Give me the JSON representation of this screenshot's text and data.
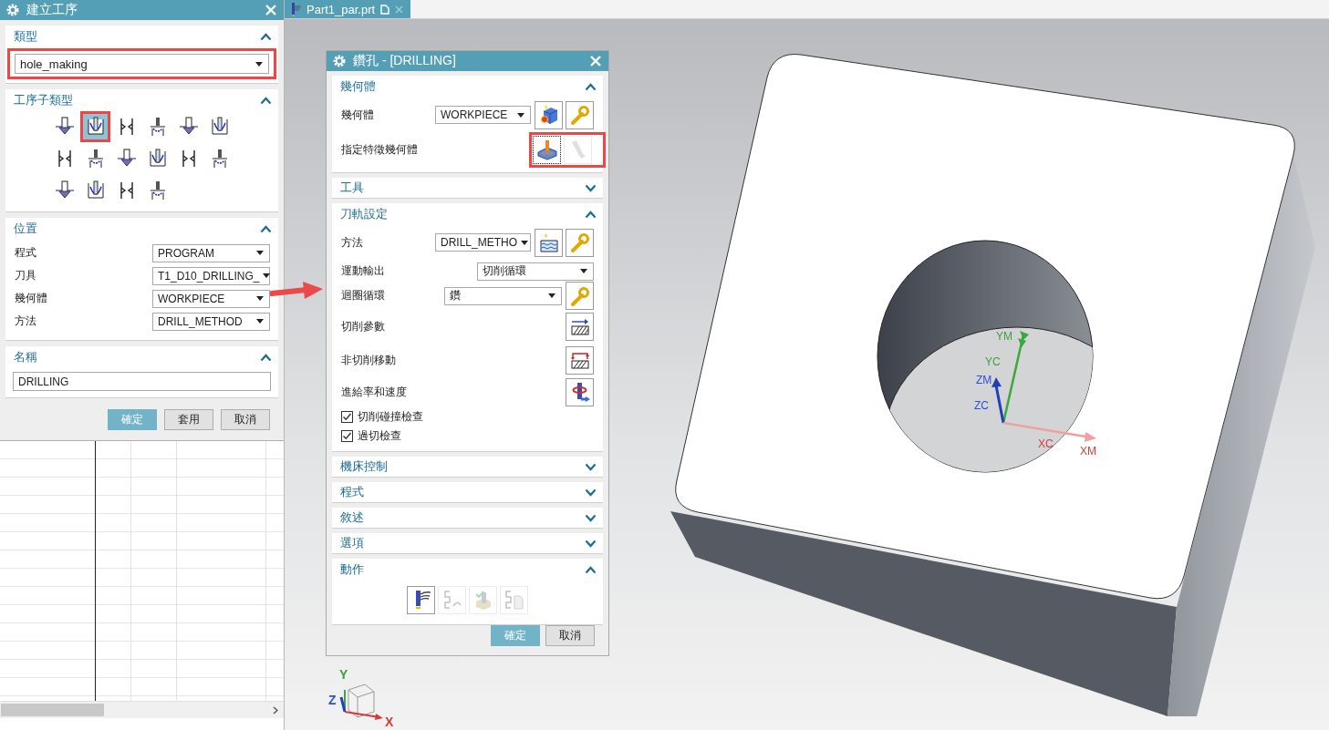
{
  "left_dialog": {
    "title": "建立工序",
    "sections": [
      {
        "kind": "type",
        "title": "類型",
        "expanded": true,
        "value": "hole_making",
        "highlighted": true
      },
      {
        "kind": "subtypes",
        "title": "工序子類型",
        "expanded": true,
        "items": [
          {
            "selected": false,
            "highlighted": false
          },
          {
            "selected": true,
            "highlighted": true
          },
          {
            "selected": false,
            "highlighted": false
          },
          {
            "selected": false,
            "highlighted": false
          },
          {
            "selected": false,
            "highlighted": false
          },
          {
            "selected": false,
            "highlighted": false
          },
          {
            "selected": false,
            "highlighted": false
          },
          {
            "selected": false,
            "highlighted": false
          },
          {
            "selected": false,
            "highlighted": false
          },
          {
            "selected": false,
            "highlighted": false
          },
          {
            "selected": false,
            "highlighted": false
          },
          {
            "selected": false,
            "highlighted": false
          },
          {
            "selected": false,
            "highlighted": false
          },
          {
            "selected": false,
            "highlighted": false
          },
          {
            "selected": false,
            "highlighted": false
          },
          {
            "selected": false,
            "highlighted": false
          }
        ]
      },
      {
        "kind": "fields",
        "title": "位置",
        "expanded": true,
        "fields": [
          {
            "label": "程式",
            "value": "PROGRAM"
          },
          {
            "label": "刀具",
            "value": "T1_D10_DRILLING_"
          },
          {
            "label": "幾何體",
            "value": "WORKPIECE"
          },
          {
            "label": "方法",
            "value": "DRILL_METHOD"
          }
        ]
      },
      {
        "kind": "name",
        "title": "名稱",
        "expanded": true,
        "value": "DRILLING"
      }
    ],
    "buttons": [
      {
        "label": "確定",
        "kind": "primary"
      },
      {
        "label": "套用",
        "kind": "normal"
      },
      {
        "label": "取消",
        "kind": "normal"
      }
    ]
  },
  "part_tab": {
    "label": "Part1_par.prt"
  },
  "drill_dialog": {
    "title": "鑽孔 - [DRILLING]",
    "sections": [
      {
        "title": "幾何體",
        "expanded": true,
        "rows": [
          {
            "kind": "geometry",
            "label": "幾何體",
            "value": "WORKPIECE"
          },
          {
            "kind": "feature",
            "label": "指定特徵幾何體",
            "highlighted": true,
            "tools": [
              {
                "disabled": false
              },
              {
                "disabled": true
              }
            ]
          }
        ]
      },
      {
        "title": "工具",
        "expanded": false
      },
      {
        "title": "刀軌設定",
        "expanded": true,
        "rows": [
          {
            "kind": "method",
            "label": "方法",
            "value": "DRILL_METHO"
          },
          {
            "kind": "motion",
            "label": "運動輸出",
            "value": "切削循環"
          },
          {
            "kind": "cycle",
            "label": "迴圈循環",
            "value": "鑽"
          },
          {
            "kind": "cut-params",
            "label": "切削參數"
          },
          {
            "kind": "non-cut",
            "label": "非切削移動"
          },
          {
            "kind": "feeds",
            "label": "進給率和速度"
          },
          {
            "kind": "checkbox",
            "label": "切削碰撞檢查",
            "checked": true
          },
          {
            "kind": "checkbox",
            "label": "過切檢查",
            "checked": true
          }
        ]
      },
      {
        "title": "機床控制",
        "expanded": false
      },
      {
        "title": "程式",
        "expanded": false
      },
      {
        "title": "敘述",
        "expanded": false
      },
      {
        "title": "選項",
        "expanded": false
      },
      {
        "title": "動作",
        "expanded": true,
        "rows": [
          {
            "kind": "actions",
            "tools": [
              {
                "disabled": false
              },
              {
                "disabled": true
              },
              {
                "disabled": true
              },
              {
                "disabled": true
              }
            ]
          }
        ]
      }
    ],
    "buttons": [
      {
        "label": "確定",
        "kind": "primary"
      },
      {
        "label": "取消",
        "kind": "normal"
      }
    ]
  },
  "viewport": {
    "axis_labels": [
      {
        "label": "YM",
        "color": "#3f9e3f"
      },
      {
        "label": "YC",
        "color": "#3f9e3f"
      },
      {
        "label": "ZM",
        "color": "#2b4fd8"
      },
      {
        "label": "ZC",
        "color": "#2b4fd8"
      },
      {
        "label": "XC",
        "color": "#d83a3a"
      },
      {
        "label": "XM",
        "color": "#d83a3a"
      }
    ],
    "view_triad_labels": [
      {
        "label": "Y",
        "color": "#3f9e3f"
      },
      {
        "label": "Z",
        "color": "#2b4fd8"
      },
      {
        "label": "X",
        "color": "#d83a3a"
      }
    ]
  }
}
